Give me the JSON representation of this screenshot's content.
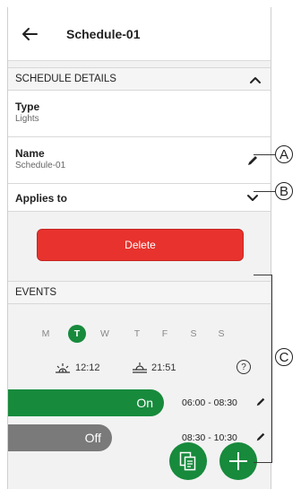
{
  "header": {
    "title": "Schedule-01",
    "back_icon": "arrow-left-icon"
  },
  "schedule_details": {
    "title": "SCHEDULE DETAILS",
    "type_label": "Type",
    "type_value": "Lights",
    "name_label": "Name",
    "name_value": "Schedule-01",
    "applies_label": "Applies to"
  },
  "delete_label": "Delete",
  "events": {
    "title": "EVENTS",
    "days": [
      "M",
      "T",
      "W",
      "T",
      "F",
      "S",
      "S"
    ],
    "selected_day_index": 1,
    "sunrise_time": "12:12",
    "sunset_time": "21:51",
    "help_symbol": "?",
    "items": [
      {
        "state": "On",
        "time": "06:00 - 08:30",
        "color": "#178a3c"
      },
      {
        "state": "Off",
        "time": "08:30 - 10:30",
        "color": "#7a7a7a"
      }
    ]
  },
  "callouts": [
    "A",
    "B",
    "C"
  ],
  "colors": {
    "accent": "#178a3c",
    "danger": "#e8322d",
    "off": "#7a7a7a"
  }
}
